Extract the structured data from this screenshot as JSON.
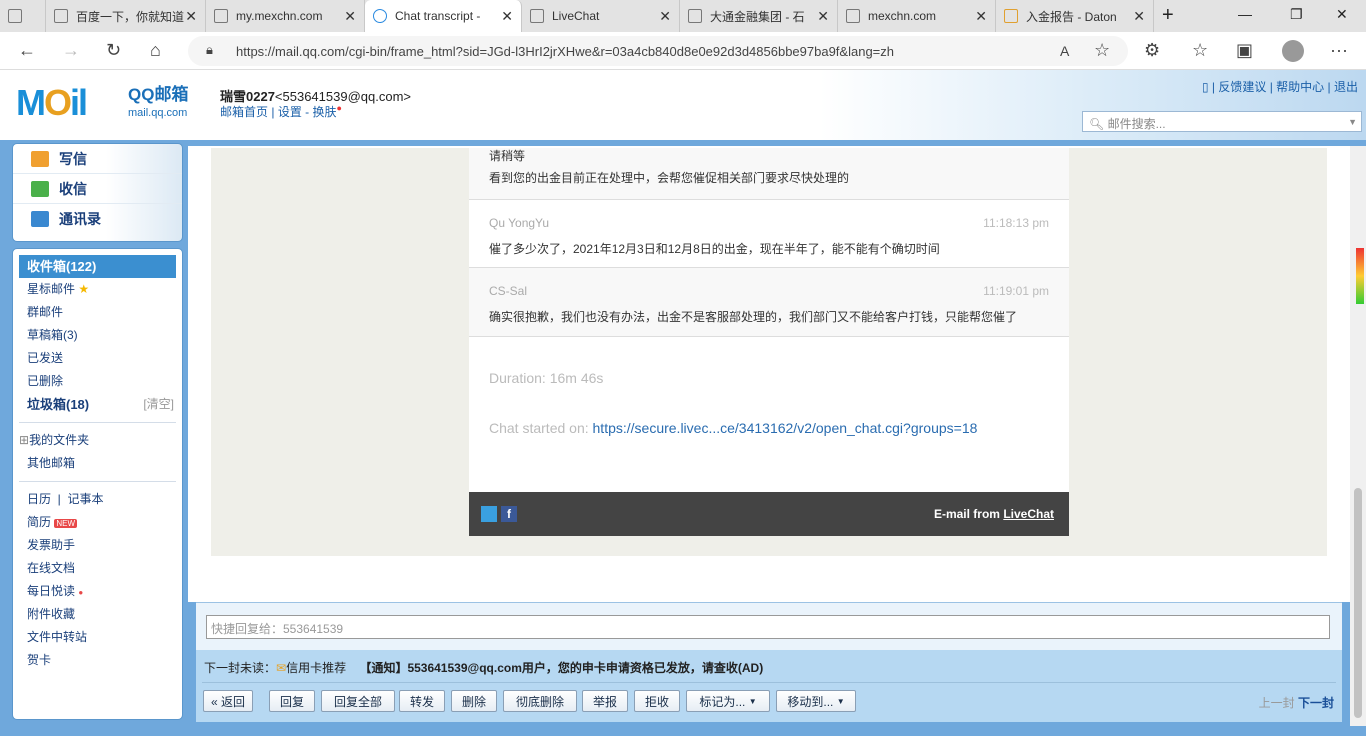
{
  "browser": {
    "tabs": [
      {
        "label": "百度一下，你就知道"
      },
      {
        "label": "my.mexchn.com"
      },
      {
        "label": "Chat transcript - "
      },
      {
        "label": "LiveChat"
      },
      {
        "label": "大通金融集团 - 石"
      },
      {
        "label": "mexchn.com"
      },
      {
        "label": "入金报告 - Daton"
      }
    ],
    "url": "https://mail.qq.com/cgi-bin/frame_html?sid=JGd-l3HrI2jrXHwe&r=03a4cb840d8e0e92d3d4856bbe97ba9f&lang=zh"
  },
  "header": {
    "logo": "MOil",
    "brand": "QQ邮箱",
    "brand_sub": "mail.qq.com",
    "user_name": "瑞雪0227",
    "user_email": "<553641539@qq.com>",
    "links": [
      "邮箱首页",
      "设置",
      "换肤"
    ],
    "top_links": [
      "反馈建议",
      "帮助中心",
      "退出"
    ],
    "search_placeholder": "邮件搜索..."
  },
  "sidebar": {
    "actions": [
      "写信",
      "收信",
      "通讯录"
    ],
    "folders": [
      {
        "label": "收件箱(122)"
      },
      {
        "label": "星标邮件"
      },
      {
        "label": "群邮件"
      },
      {
        "label": "草稿箱(3)"
      },
      {
        "label": "已发送"
      },
      {
        "label": "已删除"
      },
      {
        "label": "垃圾箱(18)"
      }
    ],
    "clear": "[清空]",
    "my_folders": "我的文件夹",
    "other": "其他邮箱",
    "calendar": "日历",
    "notes": "记事本",
    "tools": [
      "简历",
      "发票助手",
      "在线文档",
      "每日悦读",
      "附件收藏",
      "文件中转站",
      "贺卡"
    ],
    "new_badge": "NEW"
  },
  "chat": {
    "messages": [
      {
        "name": "",
        "time": "",
        "lines": [
          "请稍等",
          "看到您的出金目前正在处理中，会帮您催促相关部门要求尽快处理的"
        ]
      },
      {
        "name": "Qu YongYu",
        "time": "11:18:13 pm",
        "lines": [
          "催了多少次了，2021年12月3日和12月8日的出金，现在半年了，能不能有个确切时间"
        ]
      },
      {
        "name": "CS-Sal",
        "time": "11:19:01 pm",
        "lines": [
          "确实很抱歉，我们也没有办法，出金不是客服部处理的，我们部门又不能给客户打钱，只能帮您催了"
        ]
      }
    ],
    "duration": "Duration: 16m 46s",
    "started_label": "Chat started on: ",
    "started_url": "https://secure.livec...ce/3413162/v2/open_chat.cgi?groups=18",
    "footer_prefix": "E-mail from ",
    "footer_link": "LiveChat"
  },
  "reply": {
    "placeholder": "快捷回复给：553641539"
  },
  "toolbar": {
    "next_label": "下一封未读：",
    "next_sender": "信用卡推荐",
    "next_subject": "【通知】553641539@qq.com用户，您的申卡申请资格已发放，请查收(AD)",
    "buttons": [
      "« 返回",
      "回复",
      "回复全部",
      "转发",
      "删除",
      "彻底删除",
      "举报",
      "拒收",
      "标记为...",
      "移动到..."
    ],
    "prev": "上一封",
    "next": "下一封"
  }
}
